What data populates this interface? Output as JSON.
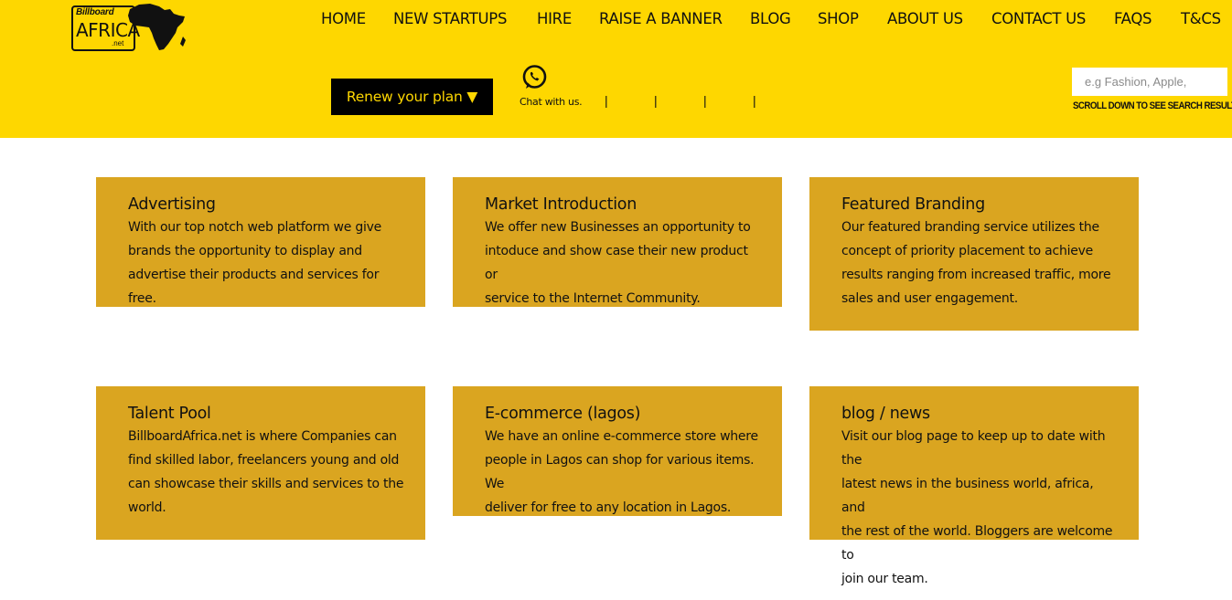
{
  "logo": {
    "line1": "Billboard",
    "line2": "AFRICA",
    "line3": ".net"
  },
  "nav": [
    {
      "label": "HOME"
    },
    {
      "label": "NEW STARTUPS"
    },
    {
      "label": "HIRE"
    },
    {
      "label": "RAISE A BANNER"
    },
    {
      "label": "BLOG"
    },
    {
      "label": "SHOP"
    },
    {
      "label": "ABOUT US"
    },
    {
      "label": "CONTACT US"
    },
    {
      "label": "FAQS"
    },
    {
      "label": "T&CS"
    }
  ],
  "renew": {
    "label": "Renew your plan ▼"
  },
  "chat": {
    "label": "Chat with us."
  },
  "separators": [
    "|",
    "|",
    "|",
    "|"
  ],
  "search": {
    "placeholder": "e.g Fashion, Apple, ",
    "hint": "SCROLL DOWN TO SEE SEARCH RESULTS"
  },
  "colors": {
    "header": "#fed700",
    "card": "#daa520",
    "button": "#000000",
    "button_text": "#fed700"
  },
  "cards": [
    {
      "title": "Advertising",
      "lines": [
        "With our top notch web platform we give",
        "brands the opportunity to display and",
        "advertise their products and services for free."
      ]
    },
    {
      "title": "Market Introduction",
      "lines": [
        "We offer new Businesses an opportunity to",
        "intoduce and show case their new product or",
        "service to the Internet Community."
      ]
    },
    {
      "title": "Featured Branding",
      "lines": [
        "Our featured branding service utilizes the",
        "concept of priority placement to achieve",
        "results ranging from increased traffic, more",
        "sales and user engagement."
      ]
    },
    {
      "title": "Talent Pool",
      "lines": [
        "BillboardAfrica.net is where Companies can",
        "find skilled labor, freelancers young and old",
        "can showcase their skills and services to the",
        "world."
      ]
    },
    {
      "title": "E-commerce (lagos)",
      "lines": [
        "We have an online e-commerce store where",
        "people in Lagos can shop for various items. We",
        "deliver for free to any location in Lagos."
      ]
    },
    {
      "title": "blog / news",
      "lines": [
        "Visit our blog page to keep up to date with the",
        "latest news in the business world, africa, and",
        "the rest of the world. Bloggers are welcome to",
        "join our team."
      ]
    }
  ]
}
